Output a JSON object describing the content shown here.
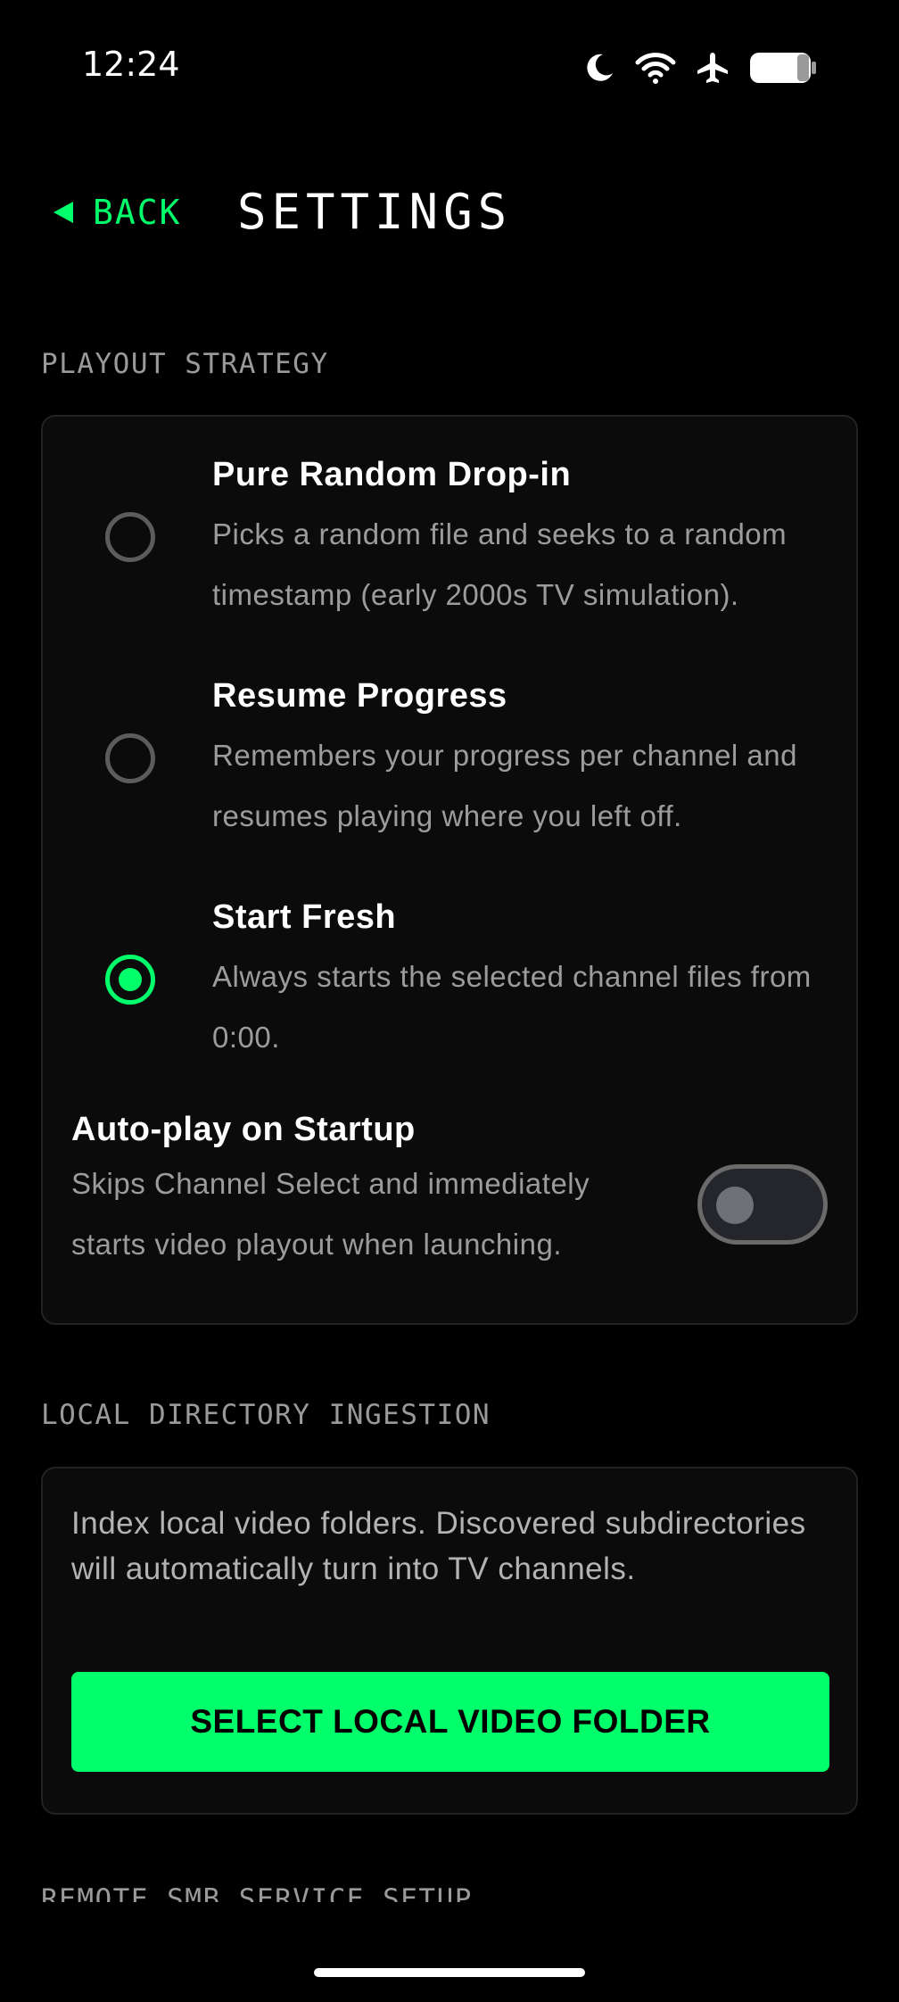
{
  "status_bar": {
    "time": "12:24",
    "icons": [
      "moon-icon",
      "wifi-icon",
      "airplane-icon",
      "battery-icon"
    ]
  },
  "header": {
    "back_label": "BACK",
    "title": "SETTINGS"
  },
  "playout": {
    "section_label": "PLAYOUT STRATEGY",
    "options": [
      {
        "title": "Pure Random Drop-in",
        "description": "Picks a random file and seeks to a random timestamp (early 2000s TV simulation).",
        "selected": false
      },
      {
        "title": "Resume Progress",
        "description": "Remembers your progress per channel and resumes playing where you left off.",
        "selected": false
      },
      {
        "title": "Start Fresh",
        "description": "Always starts the selected channel files from 0:00.",
        "selected": true
      }
    ],
    "autoplay": {
      "title": "Auto-play on Startup",
      "description": "Skips Channel Select and immediately starts video playout when launching.",
      "enabled": false
    }
  },
  "ingestion": {
    "section_label": "LOCAL DIRECTORY INGESTION",
    "description": "Index local video folders. Discovered subdirectories will automatically turn into TV channels.",
    "button_label": "SELECT LOCAL VIDEO FOLDER"
  },
  "remote": {
    "section_label": "REMOTE SMB SERVICE SETUP"
  },
  "colors": {
    "accent": "#00ff6a",
    "background": "#000000",
    "card": "#0b0b0b",
    "muted_text": "#9c9c9c"
  }
}
